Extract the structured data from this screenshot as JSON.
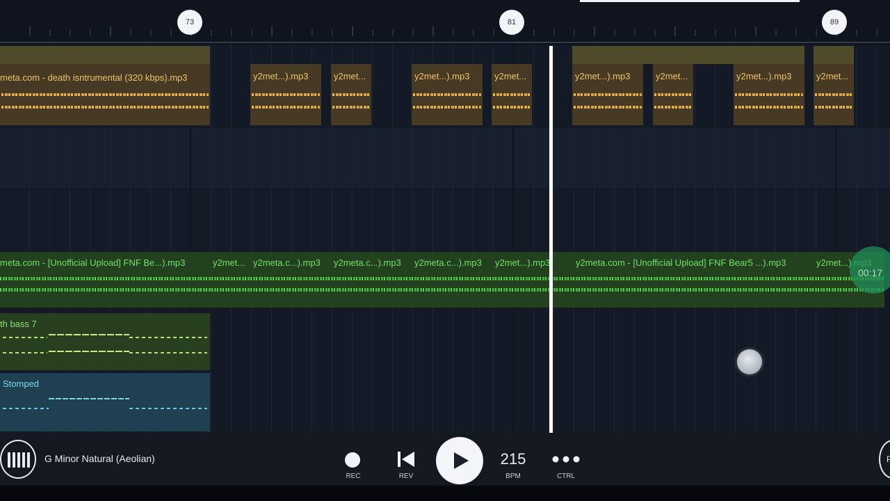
{
  "ruler": {
    "markers": [
      {
        "label": "73"
      },
      {
        "label": "81"
      },
      {
        "label": "89"
      }
    ]
  },
  "tracks": {
    "yellow_audio": [
      "meta.com - death isntrumental (320 kbps).mp3",
      "y2met...).mp3",
      "y2met...",
      "y2met...).mp3",
      "y2met...",
      "y2met...).mp3",
      "y2met...",
      "y2met...).mp3",
      "y2met..."
    ],
    "green_audio": [
      "meta.com - [Unofficial Upload] FNF Be...).mp3",
      "y2met...",
      "y2meta.c...).mp3",
      "y2meta.c...).mp3",
      "y2meta.c...).mp3",
      "y2met...).mp3",
      "y2meta.com - [Unofficial Upload] FNF Bear5 ...).mp3",
      "y2met...).mp3"
    ],
    "pattern_bass": "th bass 7",
    "pattern_stomped": "Stomped"
  },
  "playback": {
    "time_readout": "00:17"
  },
  "controls": {
    "scale": "G Minor Natural (Aeolian)",
    "rec_label": "REC",
    "rev_label": "REV",
    "bpm_value": "215",
    "bpm_label": "BPM",
    "ctrl_label": "CTRL",
    "right_button_label": "P"
  },
  "icons": {
    "piano": "piano-keys-icon",
    "rec": "record-dot-icon",
    "rev": "skip-back-icon",
    "play": "play-icon",
    "ctrl": "more-dots-icon"
  },
  "colors": {
    "yellow_clip": "#473a25",
    "yellow_text": "#f1c26a",
    "green_clip": "#24411f",
    "green_text": "#6fe26a",
    "stomped_clip": "#1f4050",
    "playhead": "#ffffff"
  }
}
